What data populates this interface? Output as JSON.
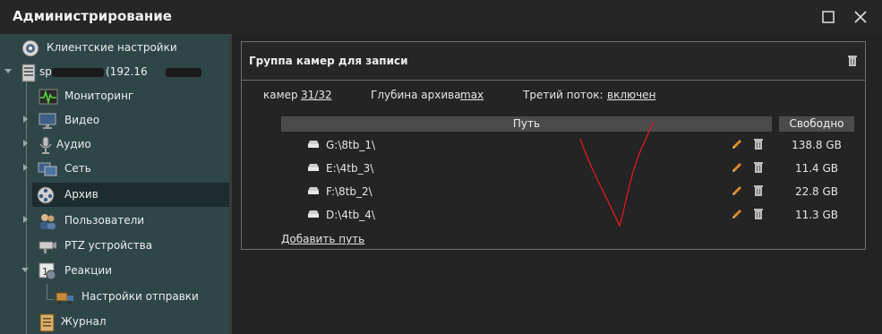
{
  "window": {
    "title": "Администрирование"
  },
  "sidebar": {
    "items": [
      {
        "label": "Клиентские настройки",
        "icon": "client-settings-icon"
      },
      {
        "label": "sp… (192.16…)",
        "icon": "server-icon"
      },
      {
        "label": "Мониторинг",
        "icon": "monitoring-icon"
      },
      {
        "label": "Видео",
        "icon": "video-icon"
      },
      {
        "label": "Аудио",
        "icon": "microphone-icon"
      },
      {
        "label": "Сеть",
        "icon": "network-icon"
      },
      {
        "label": "Архив",
        "icon": "archive-reel-icon"
      },
      {
        "label": "Пользователи",
        "icon": "users-icon"
      },
      {
        "label": "PTZ устройства",
        "icon": "ptz-camera-icon"
      },
      {
        "label": "Реакции",
        "icon": "reactions-icon"
      },
      {
        "label": "Настройки отправки",
        "icon": "delivery-truck-icon"
      },
      {
        "label": "Журнал",
        "icon": "journal-icon"
      }
    ],
    "server_label_prefix": "sp",
    "server_label_suffix": "(192.16",
    "selected": "Архив"
  },
  "panel": {
    "title": "Группа камер для записи",
    "cameras_label": "камер",
    "cameras_value": "31/32",
    "depth_label": "Глубина архива",
    "depth_value": "max",
    "third_stream_label": "Третий поток:",
    "third_stream_value": "включен",
    "col_path": "Путь",
    "col_free": "Свободно",
    "rows": [
      {
        "path": "G:\\8tb_1\\",
        "free": "138.8 GB"
      },
      {
        "path": "E:\\4tb_3\\",
        "free": "11.4 GB"
      },
      {
        "path": "F:\\8tb_2\\",
        "free": "22.8 GB"
      },
      {
        "path": "D:\\4tb_4\\",
        "free": "11.3 GB"
      }
    ],
    "add_path": "Добавить путь"
  },
  "colors": {
    "sidebar_bg": "#2f4649",
    "selected_bg": "#1d2c2e",
    "window_bg": "#232323",
    "header_fill": "#4b4b4b",
    "edit_orange": "#e08a2a",
    "scribble_red": "#e0181e"
  }
}
